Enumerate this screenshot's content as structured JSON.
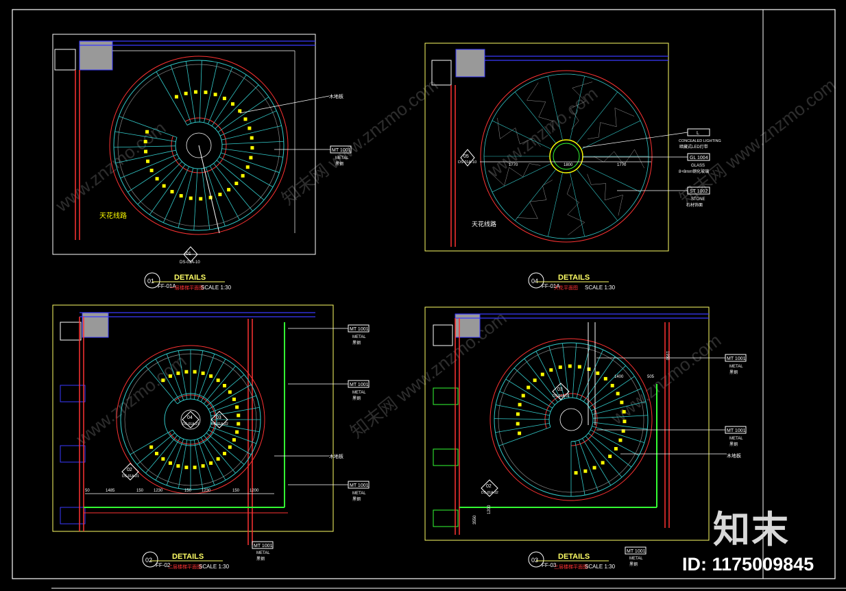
{
  "colors": {
    "background": "#000000",
    "border": "#ffffff",
    "frame": "#ffff66",
    "wall": "#ff3333",
    "blue_wall": "#3a3aff",
    "stair": "#33cccc",
    "step_mark": "#ffff00",
    "dimension": "#ffff66",
    "leader": "#ffffff",
    "green": "#33ff33",
    "gray_block": "#999999"
  },
  "panels": [
    {
      "id": "01",
      "title": "DETAILS",
      "ref": "FF-01A",
      "sub": "一层楼梯平面图",
      "scale": "SCALE  1:30",
      "notes": {
        "wood": "木地板",
        "metal_code": "MT 1001",
        "metal": "METAL",
        "metal_cn": "黑钢",
        "ceiling": "天花线路"
      },
      "section_tag": {
        "num": "01",
        "ref": "DS-01A-10"
      }
    },
    {
      "id": "04",
      "title": "DETAILS",
      "ref": "FF-01A",
      "sub": "天花平面图",
      "scale": "SCALE  1:30",
      "notes": {
        "lighting_code": "L",
        "lighting": "CONCEALED LIGHTING",
        "lighting_cn": "暗藏式LED灯带",
        "glass_code": "GL 1004",
        "glass": "GLASS",
        "glass_cn": "8+8mm钢化玻璃",
        "stone_code": "ST 1002",
        "stone": "STONE",
        "stone_cn": "石材饰面",
        "ceiling": "天花线路"
      },
      "section_tag": {
        "num": "05",
        "ref": "DS-01A-10"
      },
      "dims": [
        "1770",
        "1800",
        "1770"
      ]
    },
    {
      "id": "02",
      "title": "DETAILS",
      "ref": "FF-02",
      "sub": "二层楼梯平面图",
      "scale": "SCALE  1:30",
      "notes": {
        "wood": "木地板",
        "metal_code": "MT 1001",
        "metal": "METAL",
        "metal_cn": "黑钢"
      },
      "tags": [
        {
          "num": "04",
          "ref": "DS-01A-21"
        },
        {
          "num": "03",
          "ref": "DS-01A-22"
        },
        {
          "num": "02",
          "ref": "DS-01A-21"
        }
      ],
      "dims": [
        "50",
        "1485",
        "150",
        "1230",
        "150",
        "1230",
        "150",
        "1200"
      ]
    },
    {
      "id": "03",
      "title": "DETAILS",
      "ref": "FF-03",
      "sub": "三层楼梯平面图",
      "scale": "SCALE  1:30",
      "notes": {
        "wood": "木地板",
        "metal_code": "MT 1001",
        "metal": "METAL",
        "metal_cn": "黑钢"
      },
      "tags": [
        {
          "num": "03",
          "ref": "DS-01A-31"
        },
        {
          "num": "02",
          "ref": "DS-01A-32"
        }
      ],
      "dims": [
        "1400",
        "505",
        "1950",
        "1200",
        "3550"
      ]
    }
  ],
  "watermark": {
    "brand": "知末",
    "id": "ID: 1175009845",
    "site": "www.znzmo.com",
    "site_cn": "知末网"
  }
}
